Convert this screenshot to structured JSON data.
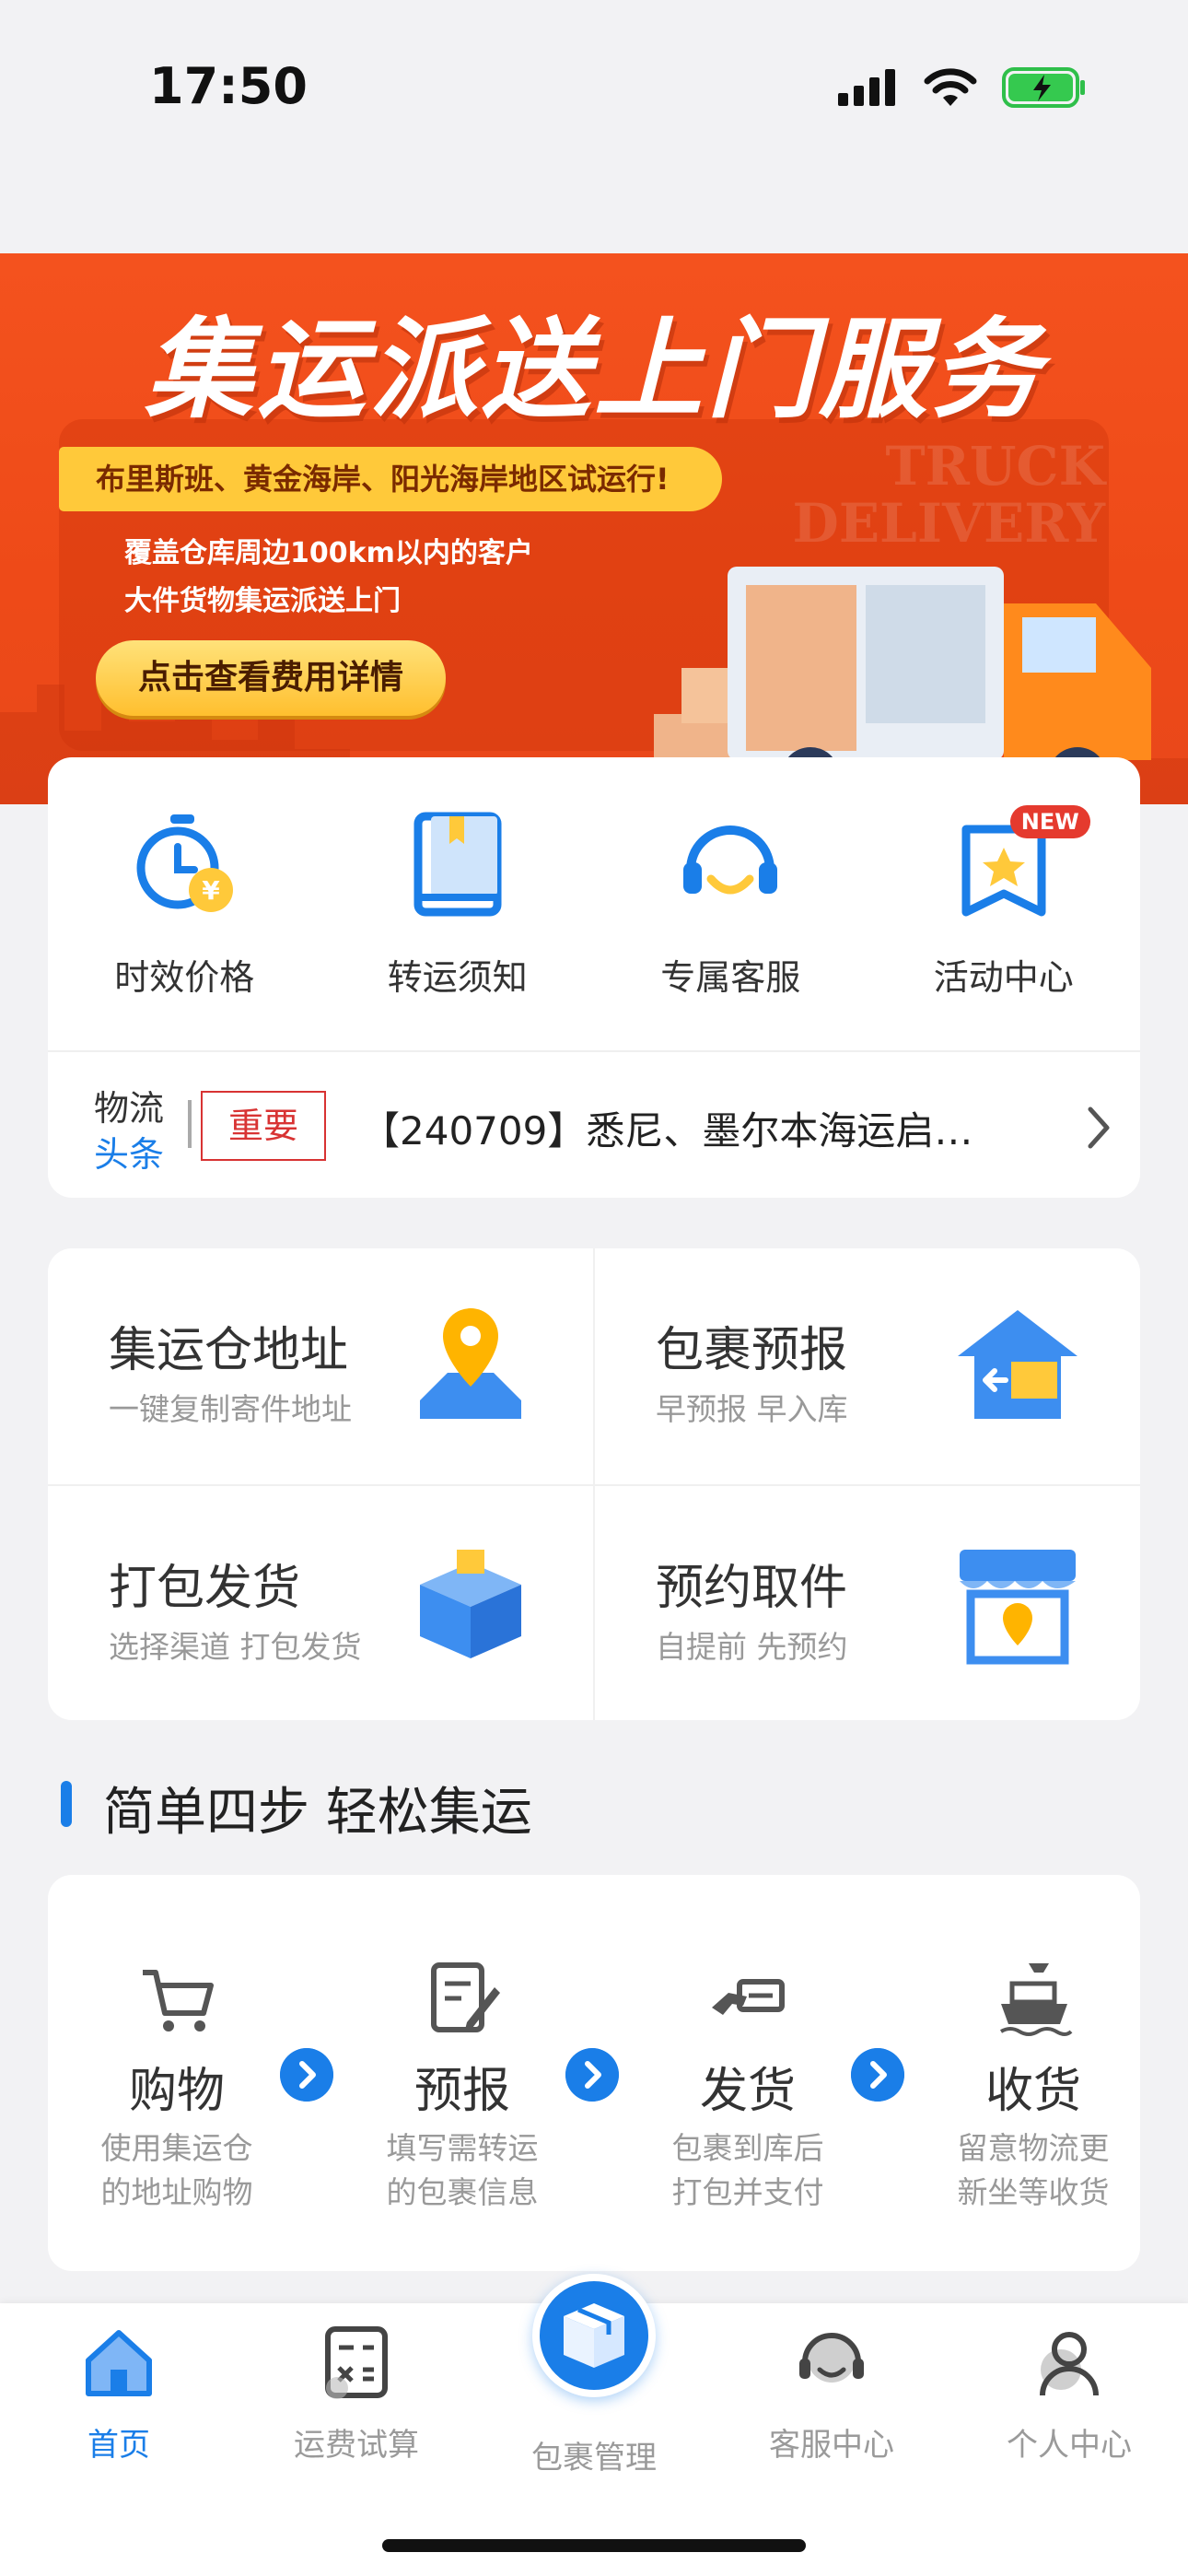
{
  "status_bar": {
    "time": "17:50"
  },
  "banner": {
    "title": "集运派送上门服务",
    "strip": "布里斯班、黄金海岸、阳光海岸地区试运行!",
    "line1": "覆盖仓库周边100km以内的客户",
    "line2": "大件货物集运派送上门",
    "cta": "点击查看费用详情",
    "ghost_text_1": "TRUCK",
    "ghost_text_2": "DELIVERY"
  },
  "quick_links": [
    {
      "label": "时效价格",
      "icon": "stopwatch-yen-icon"
    },
    {
      "label": "转运须知",
      "icon": "book-icon"
    },
    {
      "label": "专属客服",
      "icon": "headset-icon"
    },
    {
      "label": "活动中心",
      "icon": "star-badge-icon",
      "badge": "NEW"
    }
  ],
  "news": {
    "logo_line1": "物流",
    "logo_line2": "头条",
    "tag": "重要",
    "headline": "【240709】悉尼、墨尔本海运启…"
  },
  "services": [
    {
      "title": "集运仓地址",
      "subtitle": "一键复制寄件地址",
      "icon": "map-pin-icon"
    },
    {
      "title": "包裹预报",
      "subtitle": "早预报 早入库",
      "icon": "warehouse-icon"
    },
    {
      "title": "打包发货",
      "subtitle": "选择渠道 打包发货",
      "icon": "package-icon"
    },
    {
      "title": "预约取件",
      "subtitle": "自提前 先预约",
      "icon": "store-pin-icon"
    }
  ],
  "section_title": "简单四步 轻松集运",
  "steps": [
    {
      "name": "购物",
      "desc1": "使用集运仓",
      "desc2": "的地址购物",
      "icon": "cart-icon"
    },
    {
      "name": "预报",
      "desc1": "填写需转运",
      "desc2": "的包裹信息",
      "icon": "edit-doc-icon"
    },
    {
      "name": "发货",
      "desc1": "包裹到库后",
      "desc2": "打包并支付",
      "icon": "pay-card-icon"
    },
    {
      "name": "收货",
      "desc1": "留意物流更",
      "desc2": "新坐等收货",
      "icon": "ship-icon"
    }
  ],
  "tabbar": [
    {
      "label": "首页",
      "icon": "home-icon",
      "active": true
    },
    {
      "label": "运费试算",
      "icon": "calculator-icon"
    },
    {
      "label": "包裹管理",
      "icon": "box-icon"
    },
    {
      "label": "客服中心",
      "icon": "support-icon"
    },
    {
      "label": "个人中心",
      "icon": "user-icon"
    }
  ],
  "colors": {
    "primary": "#1a7ee8",
    "banner": "#f4521e",
    "accent": "#ffc93a",
    "tag": "#d83333"
  }
}
